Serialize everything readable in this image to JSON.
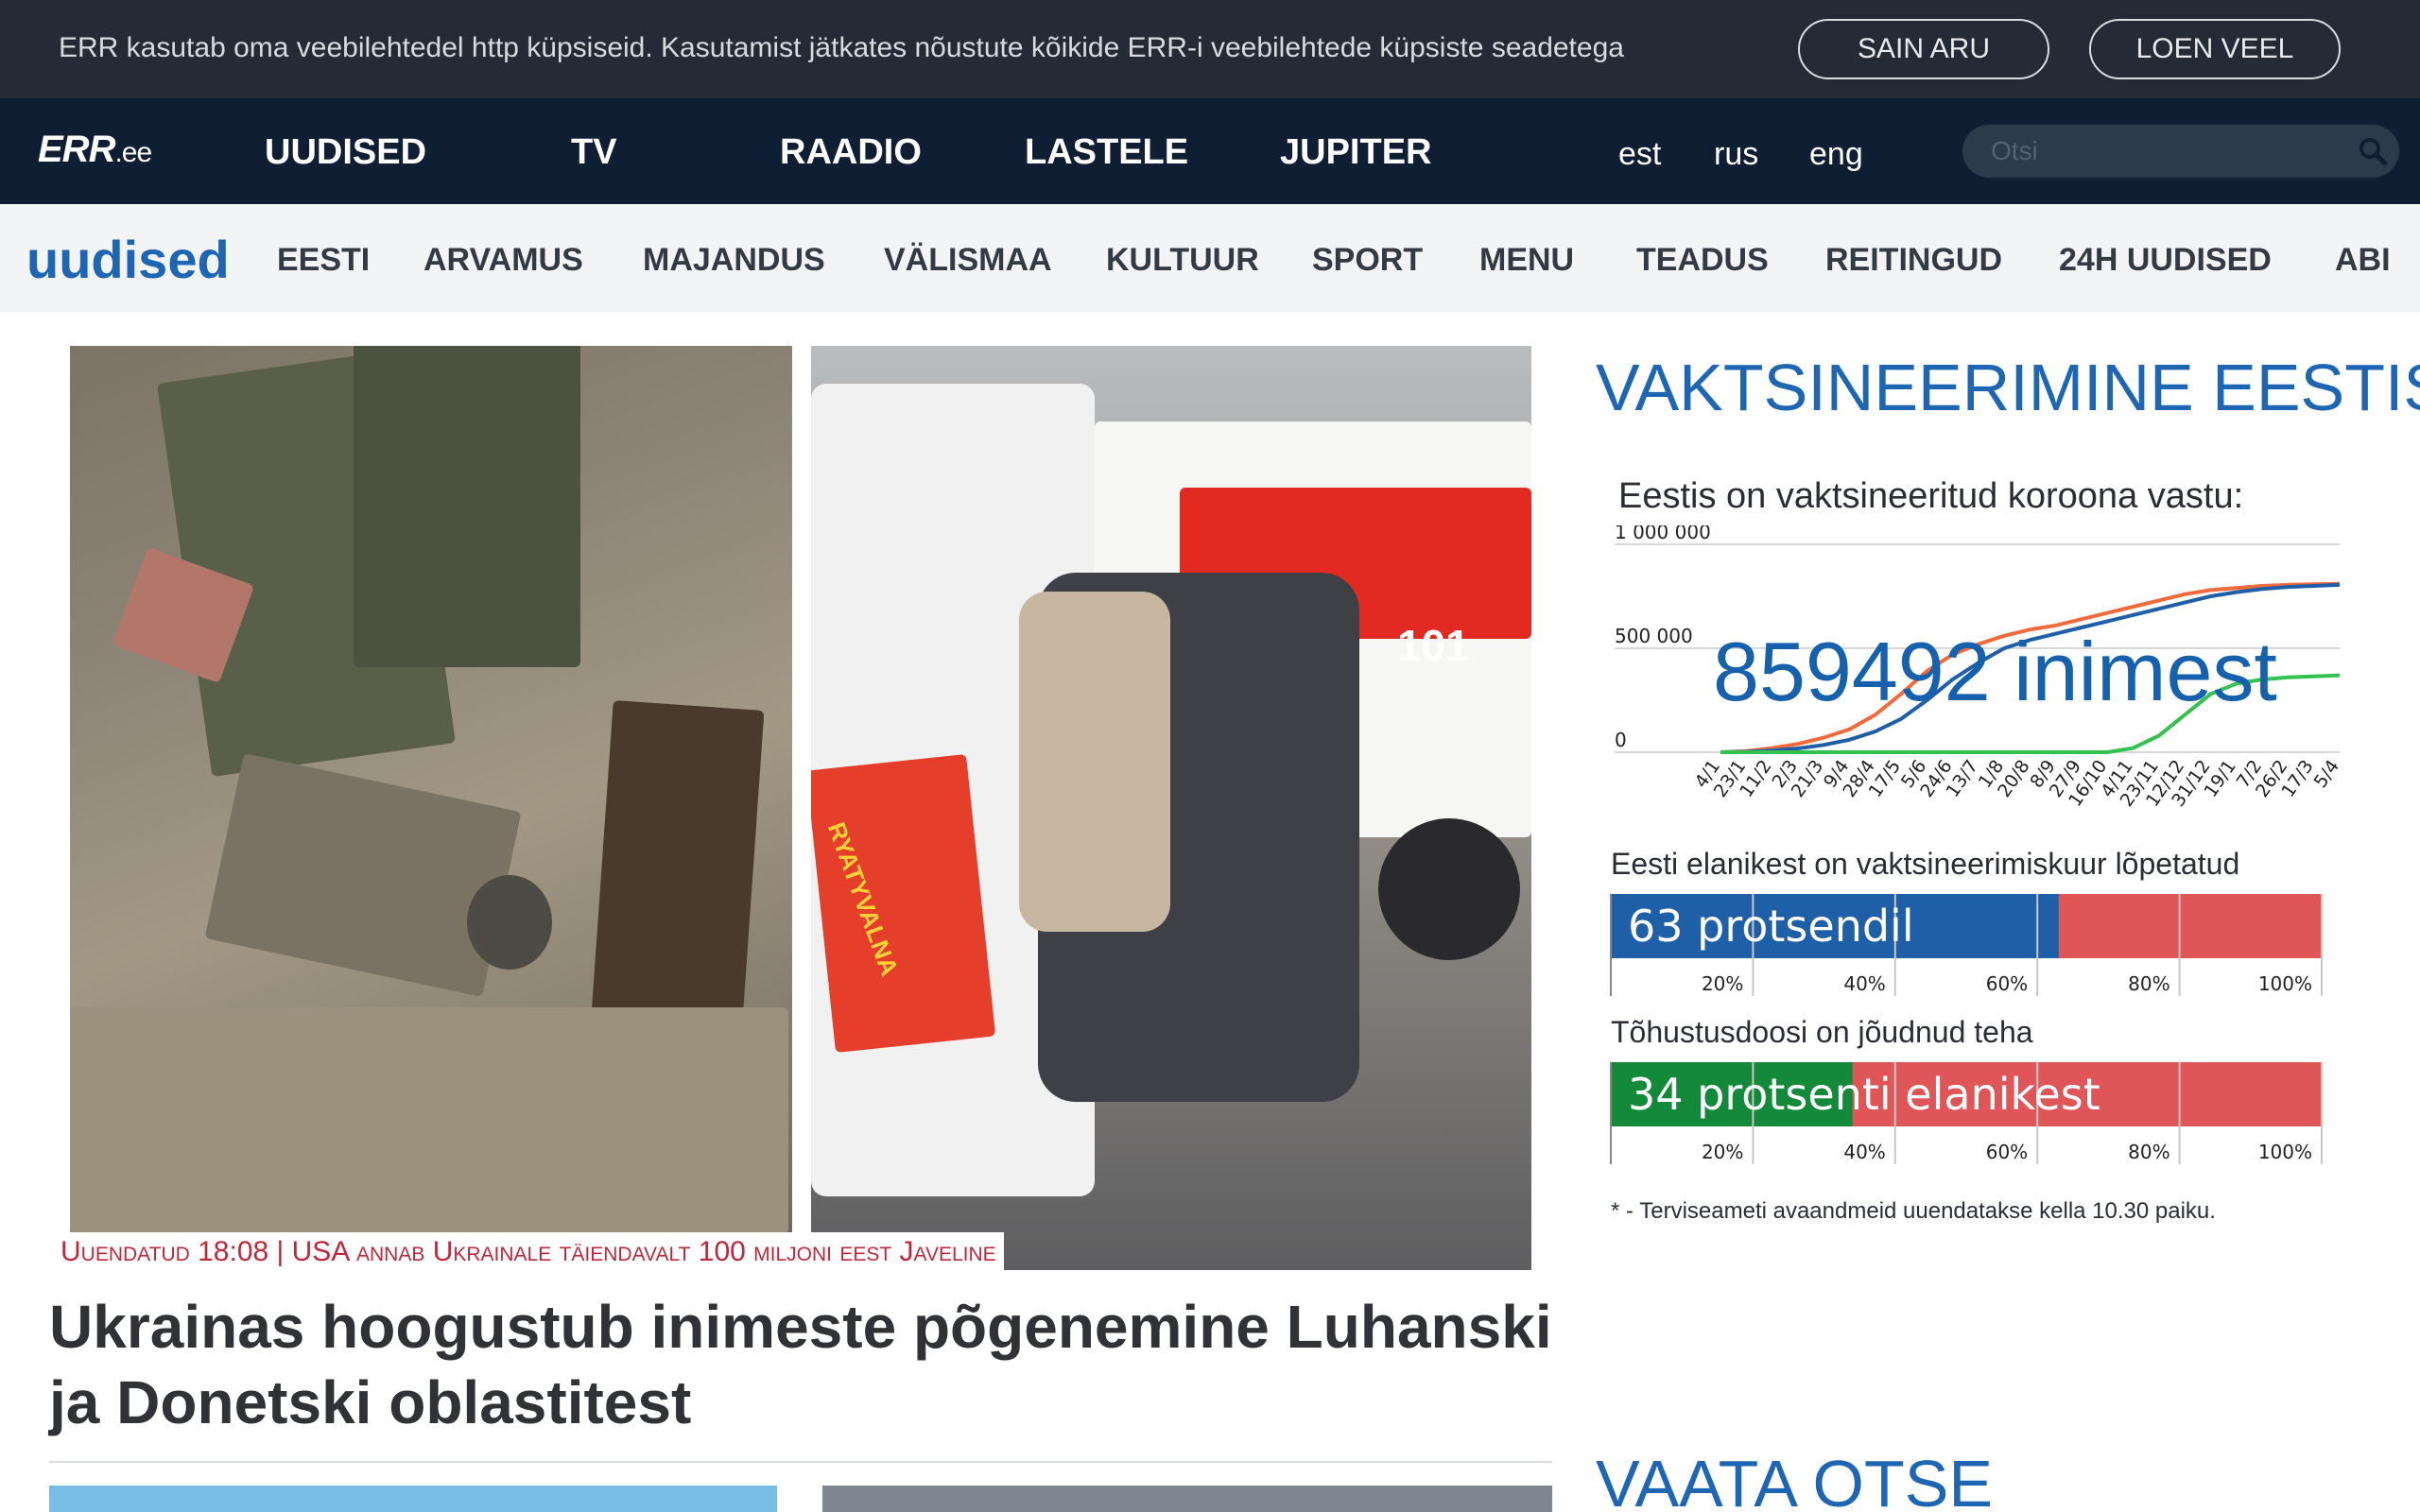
{
  "cookie": {
    "text": "ERR kasutab oma veebilehtedel http küpsiseid. Kasutamist jätkates nõustute kõikide ERR-i veebilehtede küpsiste seadetega",
    "accept_label": "SAIN ARU",
    "more_label": "LOEN VEEL"
  },
  "header": {
    "logo": "ERR",
    "logo_tld": ".ee",
    "nav": [
      "UUDISED",
      "TV",
      "RAADIO",
      "LASTELE",
      "JUPITER"
    ],
    "langs": [
      "est",
      "rus",
      "eng"
    ],
    "search_placeholder": "Otsi",
    "search_icon": "search-icon"
  },
  "subnav": {
    "section": "uudised",
    "items": [
      "EESTI",
      "ARVAMUS",
      "MAJANDUS",
      "VÄLISMAA",
      "KULTUUR",
      "SPORT",
      "MENU",
      "TEADUS",
      "REITINGUD",
      "24H UUDISED",
      "ABI"
    ]
  },
  "hero": {
    "caption": "Uuendatud 18:08 | USA annab Ukrainale täiendavalt 100 miljoni eest Javeline",
    "headline": "Ukrainas hoogustub inimeste põgenemine Luhanski ja Donetski oblastitest",
    "badge": "101",
    "vehicle_text": "RYATYVALNA"
  },
  "sidebar": {
    "title": "VAKTSINEERIMINE EESTIS",
    "chart_subtitle": "Eestis on vaktsineeritud koroona vastu:",
    "big_number": "859492 inimest",
    "bar1_label": "Eesti elanikest on vaktsineerimiskuur lõpetatud",
    "bar1_text": "63  protsendil",
    "bar2_label": "Tõhustusdoosi on jõudnud teha",
    "bar2_text": "34  protsenti elanikest",
    "footnote": "* - Terviseameti avaandmeid uuendatakse kella 10.30 paiku.",
    "live_title": "VAATA OTSE"
  },
  "chart_data": [
    {
      "type": "line",
      "title": "Eestis on vaktsineeritud koroona vastu:",
      "x": [
        "4/1",
        "23/1",
        "11/2",
        "2/3",
        "21/3",
        "9/4",
        "28/4",
        "17/5",
        "5/6",
        "24/6",
        "13/7",
        "1/8",
        "20/8",
        "8/9",
        "27/9",
        "16/10",
        "4/11",
        "23/11",
        "12/12",
        "31/12",
        "19/1",
        "7/2",
        "26/2",
        "17/3",
        "5/4"
      ],
      "yticks": [
        "0",
        "500 000",
        "1 000 000"
      ],
      "ylim": [
        0,
        1000000
      ],
      "series": [
        {
          "color": "#f06a3c",
          "values": [
            0,
            5000,
            20000,
            40000,
            70000,
            110000,
            180000,
            280000,
            390000,
            470000,
            520000,
            560000,
            590000,
            610000,
            640000,
            670000,
            700000,
            730000,
            760000,
            780000,
            790000,
            800000,
            805000,
            808000,
            810000
          ]
        },
        {
          "color": "#1f5fa8",
          "values": [
            0,
            2000,
            8000,
            18000,
            35000,
            60000,
            100000,
            160000,
            250000,
            350000,
            430000,
            500000,
            540000,
            570000,
            600000,
            630000,
            660000,
            690000,
            720000,
            750000,
            770000,
            785000,
            795000,
            800000,
            805000
          ]
        },
        {
          "color": "#33c24f",
          "values": [
            0,
            0,
            0,
            0,
            0,
            0,
            0,
            0,
            0,
            0,
            0,
            0,
            0,
            0,
            0,
            0,
            20000,
            80000,
            180000,
            280000,
            330000,
            350000,
            360000,
            365000,
            370000
          ]
        }
      ]
    },
    {
      "type": "bar",
      "title": "Eesti elanikest on vaktsineerimiskuur lõpetatud",
      "value": 63,
      "max": 100,
      "xticks": [
        "20%",
        "40%",
        "60%",
        "80%",
        "100%"
      ],
      "fill_color": "#1f5fa8",
      "rest_color": "#e05557"
    },
    {
      "type": "bar",
      "title": "Tõhustusdoosi on jõudnud teha",
      "value": 34,
      "max": 100,
      "xticks": [
        "20%",
        "40%",
        "60%",
        "80%",
        "100%"
      ],
      "fill_color": "#138a3a",
      "rest_color": "#e05557"
    }
  ]
}
